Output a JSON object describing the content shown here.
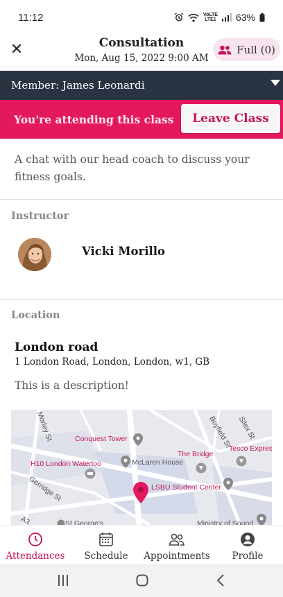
{
  "status_bar": {
    "time": "11:12",
    "network_top": "VoLTE",
    "network_bottom": "LTE1",
    "battery": "63%"
  },
  "header": {
    "close_icon": "close-icon",
    "title": "Consultation",
    "date": "Mon, Aug 15, 2022 9:00 AM",
    "capacity_label": "Full (0)"
  },
  "member_bar": {
    "label": "Member: James Leonardi"
  },
  "attendance": {
    "status_text": "You're attending this class",
    "leave_button": "Leave Class"
  },
  "class_description": "A chat with our head coach to discuss your fitness goals.",
  "instructor": {
    "section_label": "Instructor",
    "name": "Vicki Morillo"
  },
  "location": {
    "section_label": "Location",
    "name": "London road",
    "address": "1 London Road, London, London, w1, GB",
    "description": "This is a description!",
    "map_labels": {
      "street_1": "Morley St",
      "street_2": "Boyfield St",
      "street_3": "Silex St",
      "street_4": "Gerridge St",
      "street_5": "A3",
      "poi_1": "Conquest Tower",
      "poi_2": "McLaren House",
      "poi_3": "The Bridge",
      "poi_4": "Tesco Expres",
      "poi_5": "H10 London Waterloo",
      "poi_6": "LSBU Student Center",
      "poi_7": "St George's",
      "poi_8": "Ministry of Sound"
    }
  },
  "bottom_nav": {
    "items": [
      {
        "label": "Attendances",
        "icon": "clock-icon",
        "active": true
      },
      {
        "label": "Schedule",
        "icon": "calendar-icon",
        "active": false
      },
      {
        "label": "Appointments",
        "icon": "people-icon",
        "active": false
      },
      {
        "label": "Profile",
        "icon": "profile-icon",
        "active": false
      }
    ]
  },
  "colors": {
    "accent": "#e3185f",
    "accent_dark": "#c8145a",
    "member_bar": "#2a3342",
    "badge_bg": "#f7e4ee"
  }
}
